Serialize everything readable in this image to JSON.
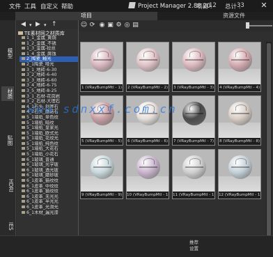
{
  "menu": {
    "file": "文件",
    "tools": "工具",
    "custom": "自定义",
    "help": "帮助"
  },
  "app": {
    "title": "Project Manager 2.88.20",
    "project_label": "项目 :",
    "project_value": "12",
    "total_label": "总计 :",
    "total_value": "33"
  },
  "tabs": {
    "project": "项目",
    "resource_files": "资源文件"
  },
  "vertical_tabs": [
    "模型",
    "材质",
    "贴图",
    "HDRI",
    "IES"
  ],
  "tree": {
    "root": "TE素材网之材质库",
    "items": [
      "1_1_金属_黄铜",
      "1_2_金属_不锈",
      "1_3_金属-拉丝",
      "1_4_金属_腐蚀",
      "2_陶瓷_釉光",
      "2_1陶瓷_哑光",
      "3_1_地砖-6-30",
      "3_2_地砖-6-40",
      "3_3_地砖-6-60",
      "3_4_地砖-6-75",
      "3_5_地砖-8-25",
      "3_1_石材-花岗岩",
      "3_2_石材-大理石",
      "4_1石头_剁斧石",
      "4_2石头_蘑菇石",
      "5_1墙纸_单色纹",
      "5_1墙纸_暗纹",
      "5_1墙纸_皇家光",
      "5_1墙纸_欧式光",
      "5_1墙纸_花纹光",
      "5_1墙纸_纯色纹",
      "5_1墙纸_大花石",
      "5_1墙纸_小花石",
      "6_1玻璃_普通",
      "6_1玻璃_光学玻",
      "6_1玻璃_透光玻",
      "6_1玻璃_磨砂玻",
      "6_1皮革_猫纹纹",
      "6_1皮革_中纹纹",
      "6_1皮革_猫纹纹",
      "6_1皮革_无光光",
      "6_1皮革_半光光",
      "6_1皮革_光滑光",
      "6_1木材_漏光漆"
    ]
  },
  "materials": [
    {
      "caption": "1 (VRayBumpMtl - 1)",
      "color": "#d8b6bd"
    },
    {
      "caption": "2 (VRayBumpMtl - 2)",
      "color": "#e0c2c6"
    },
    {
      "caption": "3 (VRayBumpMtl - 3)",
      "color": "#dcb8be"
    },
    {
      "caption": "4 (VRayBumpMtl - 4)",
      "color": "#d4aab0"
    },
    {
      "caption": "5 (VRayBumpMtl - 5)",
      "color": "#c79ea3"
    },
    {
      "caption": "6 (VRayBumpMtl - 6)",
      "color": "#e6e0dc"
    },
    {
      "caption": "7 (VRayBumpMtl - 7)",
      "color": "#4a4a4a"
    },
    {
      "caption": "8 (VRayBumpMtl - 8)",
      "color": "#d8ccc4"
    },
    {
      "caption": "9 (VRayBumpMtl - 9)",
      "color": "#c8d8dc"
    },
    {
      "caption": "10 (VRayBumpMtl - 10)",
      "color": "#c8b4cc"
    },
    {
      "caption": "11 (VRayBumpMtl - 11)",
      "color": "#cfcfcf"
    },
    {
      "caption": "12 (VRayBumpMtl - 12)",
      "color": "#c4d0d8"
    }
  ],
  "watermark": "www.sdnxxf.com.cn",
  "bottom": {
    "line1": "推荐",
    "line2": "设置"
  },
  "colors": {
    "selection": "#2f5fb3",
    "watermark": "#2878dc"
  }
}
